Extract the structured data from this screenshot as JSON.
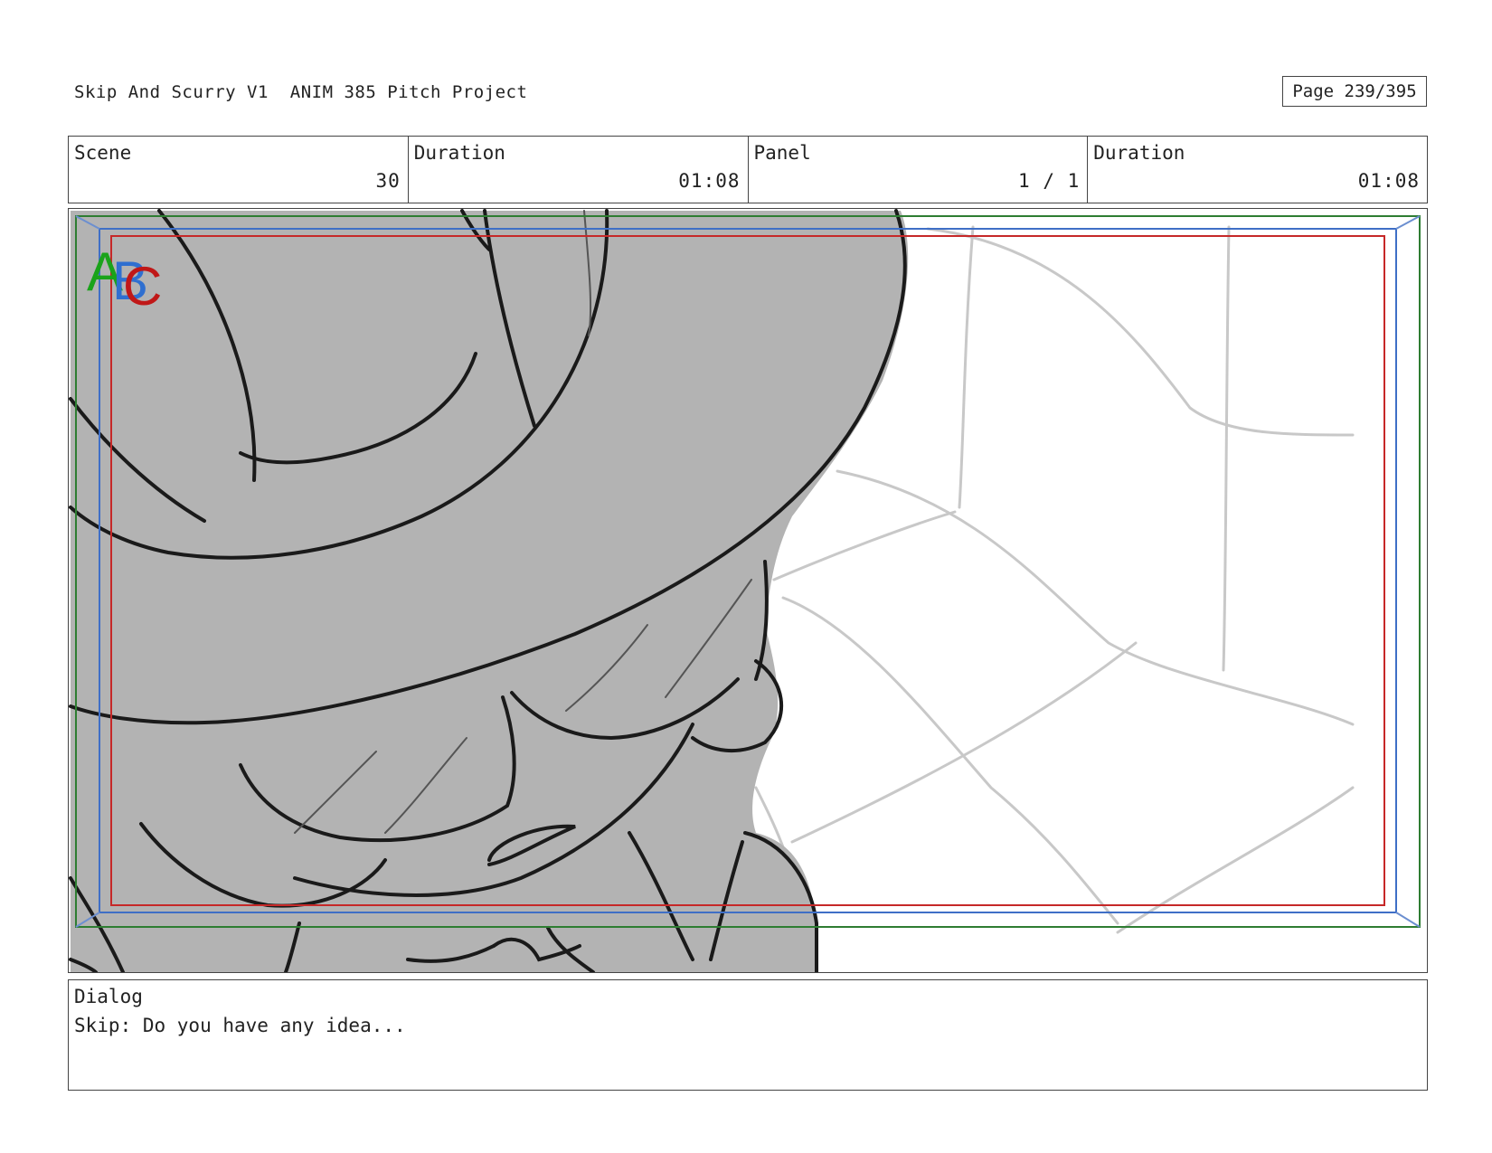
{
  "header": {
    "title": "Skip And Scurry V1  ANIM 385 Pitch Project",
    "page": "Page 239/395"
  },
  "info": {
    "scene_label": "Scene",
    "scene_value": "30",
    "duration_label": "Duration",
    "duration_value": "01:08",
    "panel_label": "Panel",
    "panel_value": "1 / 1",
    "panel_duration_label": "Duration",
    "panel_duration_value": "01:08"
  },
  "safe_area_markers": {
    "a": "A",
    "b": "B",
    "c": "C",
    "colors": {
      "a": "#1aa31a",
      "b": "#2f6fd0",
      "c": "#c01818"
    }
  },
  "dialog": {
    "label": "Dialog",
    "text": "Skip: Do you have any idea..."
  }
}
